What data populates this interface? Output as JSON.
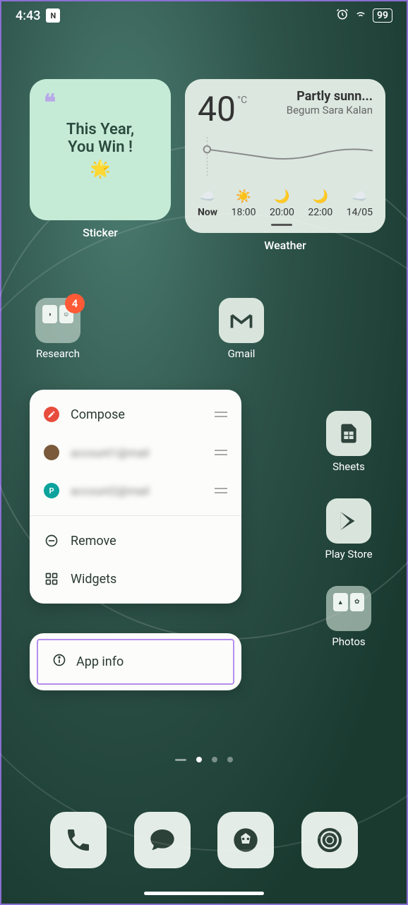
{
  "statusbar": {
    "time": "4:43",
    "battery": "99"
  },
  "sticker": {
    "line1": "This Year,",
    "line2": "You Win !",
    "label": "Sticker"
  },
  "weather": {
    "temp": "40",
    "unit": "°C",
    "desc": "Partly sunn...",
    "location": "Begum Sara Kalan",
    "hours": [
      {
        "label": "Now"
      },
      {
        "label": "18:00"
      },
      {
        "label": "20:00"
      },
      {
        "label": "22:00"
      },
      {
        "label": "14/05"
      }
    ],
    "widget_label": "Weather"
  },
  "apps": {
    "research": {
      "label": "Research",
      "badge": "4"
    },
    "gmail": {
      "label": "Gmail"
    },
    "sheets": {
      "label": "Sheets"
    },
    "playstore": {
      "label": "Play Store"
    },
    "photos": {
      "label": "Photos"
    }
  },
  "menu": {
    "compose": "Compose",
    "remove": "Remove",
    "widgets": "Widgets",
    "appinfo": "App info",
    "account1": "account1@mail",
    "account2": "account2@mail",
    "avatar2_letter": "P"
  }
}
